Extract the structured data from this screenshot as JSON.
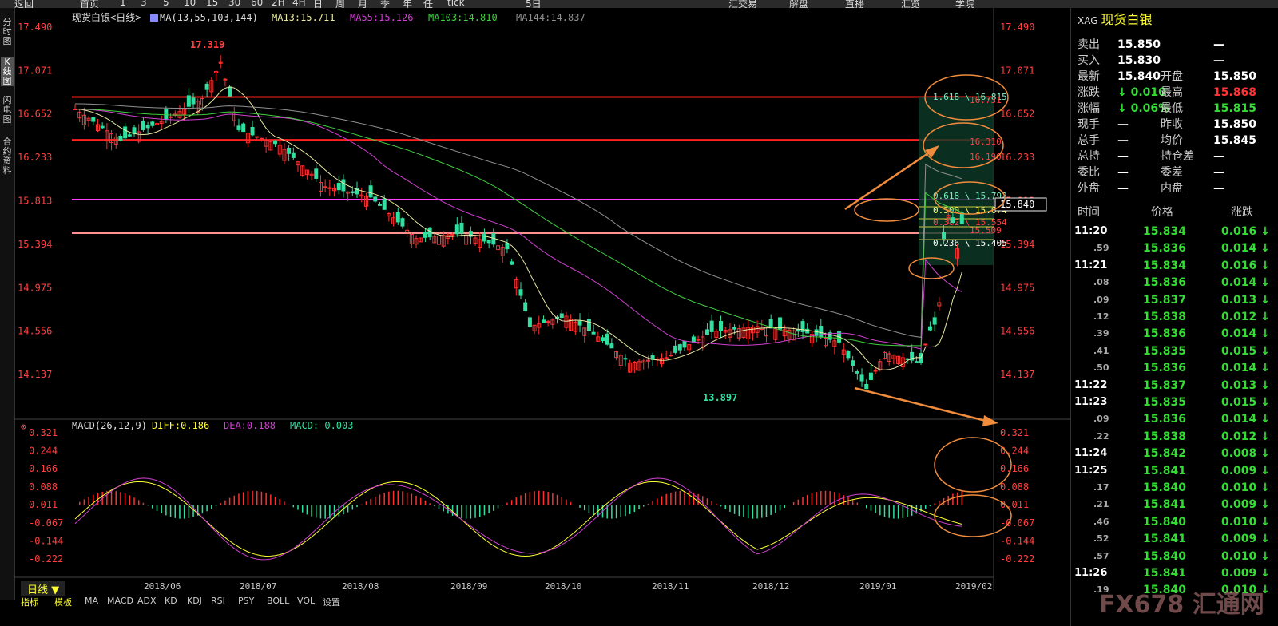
{
  "toolbar": {
    "items": [
      "返回",
      "首页",
      "1",
      "3",
      "5",
      "10",
      "15",
      "30",
      "60",
      "2H",
      "4H",
      "日",
      "周",
      "月",
      "季",
      "年",
      "任",
      "tick",
      "",
      "5日",
      "",
      "",
      "",
      "",
      "",
      "汇交易",
      "解盘",
      "直播",
      "汇览",
      "学院"
    ]
  },
  "left_tabs": [
    "分时图",
    "K线图",
    "闪电图",
    "合约资料"
  ],
  "chart": {
    "name": "现货白银",
    "period": "日线",
    "ma_label": "MA(13,55,103,144)",
    "ma13": "MA13:15.711",
    "ma55": "MA55:15.126",
    "ma103": "MA103:14.810",
    "ma144": "MA144:14.837",
    "high_label": "17.319",
    "low_label": "13.897",
    "price_ticks": [
      "17.490",
      "17.071",
      "16.652",
      "16.233",
      "15.813",
      "15.394",
      "14.975",
      "14.556",
      "14.137"
    ],
    "current_price_label": "15.840",
    "fib_labels": [
      "1.618 \\ 16.815",
      "16.731",
      "16.310",
      "16.190",
      "0.618 \\ 15.792",
      "0.500 \\ 15.674",
      "0.382 \\ 15.554",
      "15.509",
      "0.236 \\ 15.405"
    ],
    "macd_label": "MACD(26,12,9)",
    "diff": "DIFF:0.186",
    "dea": "DEA:0.188",
    "macd": "MACD:-0.003",
    "macd_ticks": [
      "0.321",
      "0.244",
      "0.166",
      "0.088",
      "0.011",
      "-0.067",
      "-0.144",
      "-0.222"
    ],
    "x_ticks": [
      "2018/06",
      "2018/07",
      "2018/08",
      "2018/09",
      "2018/10",
      "2018/11",
      "2018/12",
      "2019/01",
      "2019/02"
    ],
    "colors": {
      "up": "#ff3030",
      "down": "#30e0a0",
      "ma13": "#e8e8a0",
      "ma55": "#d040d0",
      "ma103": "#40d040",
      "ma144": "#909090",
      "hline_red": "#ff2020",
      "hline_magenta": "#ff40ff",
      "hline_pink": "#ff9090",
      "annot": "#f08c3c"
    }
  },
  "chart_data": {
    "type": "line",
    "title": "现货白银",
    "x": [
      "2018/06",
      "2018/07",
      "2018/08",
      "2018/09",
      "2018/10",
      "2018/11",
      "2018/12",
      "2019/01",
      "2019/02"
    ],
    "series": [
      {
        "name": "MA13",
        "values": [
          16.5,
          16.3,
          15.6,
          14.6,
          14.6,
          14.5,
          14.6,
          15.7,
          15.7
        ]
      },
      {
        "name": "MA55",
        "values": [
          16.6,
          16.4,
          16.0,
          15.4,
          14.9,
          14.5,
          14.4,
          14.9,
          15.1
        ]
      },
      {
        "name": "MA103",
        "values": [
          16.6,
          16.5,
          16.3,
          15.9,
          15.4,
          15.0,
          14.6,
          14.6,
          14.8
        ]
      },
      {
        "name": "MA144",
        "values": [
          16.6,
          16.5,
          16.3,
          16.0,
          15.7,
          15.4,
          15.2,
          14.9,
          14.8
        ]
      }
    ],
    "ylim": [
      13.897,
      17.49
    ]
  },
  "quote": {
    "code": "XAG",
    "name": "现货白银",
    "rows": [
      {
        "l1": "卖出",
        "v1": "15.850",
        "l2": "",
        "v2": "—"
      },
      {
        "l1": "买入",
        "v1": "15.830",
        "l2": "",
        "v2": "—"
      },
      {
        "l1": "最新",
        "v1": "15.840",
        "l2": "开盘",
        "v2": "15.850"
      },
      {
        "l1": "涨跌",
        "v1": "↓ 0.010",
        "l2": "最高",
        "v2": "15.868"
      },
      {
        "l1": "涨幅",
        "v1": "↓ 0.06%",
        "l2": "最低",
        "v2": "15.815"
      },
      {
        "l1": "现手",
        "v1": "—",
        "l2": "昨收",
        "v2": "15.850"
      },
      {
        "l1": "总手",
        "v1": "—",
        "l2": "均价",
        "v2": "15.845"
      },
      {
        "l1": "总持",
        "v1": "—",
        "l2": "持仓差",
        "v2": "—"
      },
      {
        "l1": "委比",
        "v1": "—",
        "l2": "委差",
        "v2": "—"
      },
      {
        "l1": "外盘",
        "v1": "—",
        "l2": "内盘",
        "v2": "—"
      }
    ],
    "tick_header": [
      "时间",
      "价格",
      "涨跌"
    ],
    "ticks": [
      {
        "t": "11:20",
        "p": "15.834",
        "c": "0.016"
      },
      {
        "t": ".59",
        "p": "15.836",
        "c": "0.014"
      },
      {
        "t": "11:21",
        "p": "15.834",
        "c": "0.016"
      },
      {
        "t": ".08",
        "p": "15.836",
        "c": "0.014"
      },
      {
        "t": ".09",
        "p": "15.837",
        "c": "0.013"
      },
      {
        "t": ".12",
        "p": "15.838",
        "c": "0.012"
      },
      {
        "t": ".39",
        "p": "15.836",
        "c": "0.014"
      },
      {
        "t": ".41",
        "p": "15.835",
        "c": "0.015"
      },
      {
        "t": ".50",
        "p": "15.836",
        "c": "0.014"
      },
      {
        "t": "11:22",
        "p": "15.837",
        "c": "0.013"
      },
      {
        "t": "11:23",
        "p": "15.835",
        "c": "0.015"
      },
      {
        "t": ".09",
        "p": "15.836",
        "c": "0.014"
      },
      {
        "t": ".22",
        "p": "15.838",
        "c": "0.012"
      },
      {
        "t": "11:24",
        "p": "15.842",
        "c": "0.008"
      },
      {
        "t": "11:25",
        "p": "15.841",
        "c": "0.009"
      },
      {
        "t": ".17",
        "p": "15.840",
        "c": "0.010"
      },
      {
        "t": ".21",
        "p": "15.841",
        "c": "0.009"
      },
      {
        "t": ".46",
        "p": "15.840",
        "c": "0.010"
      },
      {
        "t": ".52",
        "p": "15.841",
        "c": "0.009"
      },
      {
        "t": ".57",
        "p": "15.840",
        "c": "0.010"
      },
      {
        "t": "11:26",
        "p": "15.841",
        "c": "0.009"
      },
      {
        "t": ".19",
        "p": "15.840",
        "c": "0.010"
      }
    ]
  },
  "bottom": {
    "period_button": "日线",
    "tabs": [
      "指标",
      "模板",
      "MA",
      "MACD",
      "ADX",
      "KD",
      "KDJ",
      "RSI",
      "PSY",
      "BOLL",
      "VOL",
      "设置"
    ]
  },
  "watermark": "FX678 汇通网"
}
